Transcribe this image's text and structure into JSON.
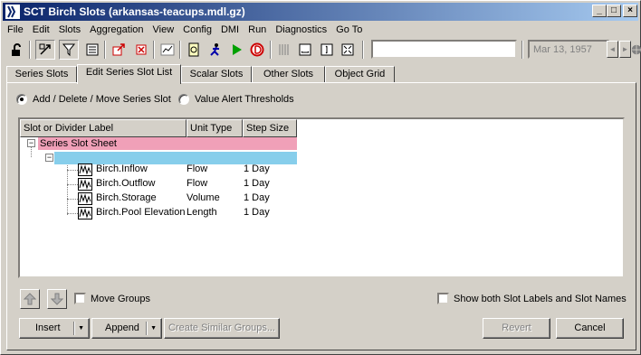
{
  "window": {
    "title": "SCT Birch Slots (arkansas-teacups.mdl.gz)",
    "minimize": "_",
    "maximize": "□",
    "close": "×"
  },
  "menu": [
    "File",
    "Edit",
    "Slots",
    "Aggregation",
    "View",
    "Config",
    "DMI",
    "Run",
    "Diagnostics",
    "Go To"
  ],
  "toolbar": {
    "search_value": "",
    "date": "Mar 13, 1957",
    "icons": [
      "unlock-icon",
      "transform-icon",
      "filter-icon",
      "aggregate-icon",
      "open-slot-icon",
      "close-slot-icon",
      "plot-icon",
      "timestep-icon",
      "run-icon",
      "play-icon",
      "stop-icon",
      "grid-icon",
      "fit-width-icon",
      "fit-height-icon",
      "fit-all-icon"
    ]
  },
  "tabs": [
    "Series Slots",
    "Edit Series Slot List",
    "Scalar Slots",
    "Other Slots",
    "Object Grid"
  ],
  "active_tab": "Edit Series Slot List",
  "mode": {
    "option_add": "Add / Delete / Move Series Slot",
    "option_alert": "Value Alert Thresholds",
    "selected": "add"
  },
  "tree": {
    "columns": [
      "Slot or Divider Label",
      "Unit Type",
      "Step Size"
    ],
    "root_label": "Series Slot Sheet",
    "root_color": "#f0a0b8",
    "group_color": "#87ceeb",
    "rows": [
      {
        "label": "Birch.Inflow",
        "unit": "Flow",
        "step": "1 Day"
      },
      {
        "label": "Birch.Outflow",
        "unit": "Flow",
        "step": "1 Day"
      },
      {
        "label": "Birch.Storage",
        "unit": "Volume",
        "step": "1 Day"
      },
      {
        "label": "Birch.Pool Elevation",
        "unit": "Length",
        "step": "1 Day"
      }
    ]
  },
  "controls": {
    "move_groups": "Move Groups",
    "show_both": "Show both Slot Labels and Slot Names",
    "insert": "Insert",
    "append": "Append",
    "create_similar": "Create Similar Groups...",
    "revert": "Revert",
    "cancel": "Cancel"
  }
}
